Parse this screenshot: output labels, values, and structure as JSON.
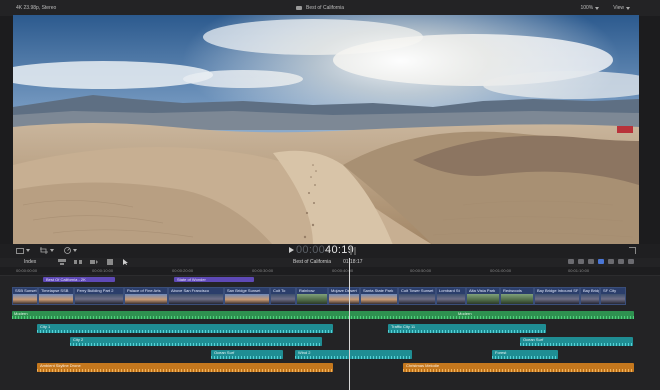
{
  "viewer": {
    "format": "4K 23.98p, Stereo",
    "project": "Best of California",
    "zoom": "100%",
    "view": "View"
  },
  "transport": {
    "timecode_dim": "00:00",
    "timecode_bright": "40:19"
  },
  "timeline_toolbar": {
    "index_label": "Index",
    "project": "Best of California",
    "duration": "01:18:17"
  },
  "ruler": {
    "ticks": [
      "00:00:00:00",
      "00:00:10:00",
      "00:00:20:00",
      "00:00:30:00",
      "00:00:40:00",
      "00:00:50:00",
      "00:01:00:00",
      "00:01:10:00"
    ]
  },
  "roles": {
    "best_of_california": "Best Of California - 2K",
    "state_of_wonder": "State of Wonder"
  },
  "clips": [
    {
      "label": "SSB Sunset",
      "style": "sky"
    },
    {
      "label": "Timelapse SSB",
      "style": "sky"
    },
    {
      "label": "Ferry Building Part 2",
      "style": "city"
    },
    {
      "label": "Palace of Fine Arts",
      "style": "sky"
    },
    {
      "label": "Above San Francisco",
      "style": "city"
    },
    {
      "label": "San Bridge Sunset",
      "style": "sky"
    },
    {
      "label": "Coit To",
      "style": "city"
    },
    {
      "label": "Rainbow",
      "style": "green"
    },
    {
      "label": "Mojave Desert",
      "style": "sky"
    },
    {
      "label": "Santa State Park",
      "style": "sky"
    },
    {
      "label": "Coit Tower Sunset",
      "style": "city"
    },
    {
      "label": "Lombard St",
      "style": "city"
    },
    {
      "label": "Alta Vista Park",
      "style": "green"
    },
    {
      "label": "Redwoods",
      "style": "green"
    },
    {
      "label": "Bay Bridge Inbound SF",
      "style": "city"
    },
    {
      "label": "Bay Bridge",
      "style": "city"
    },
    {
      "label": "SF City",
      "style": "city"
    }
  ],
  "audio": {
    "modern_a": "Modern",
    "modern_b": "Modern",
    "city1": "City 1",
    "traffic_city": "Traffic City 11",
    "city2": "City 2",
    "ocean_surf_right": "Ocean Surf",
    "ocean_surf_left": "Ocean Surf",
    "wind2": "Wind 2",
    "forest": "Forest",
    "ambient_skyline": "Ambient Skyline Drone",
    "christmas_melodie": "Christmas Melodie"
  }
}
